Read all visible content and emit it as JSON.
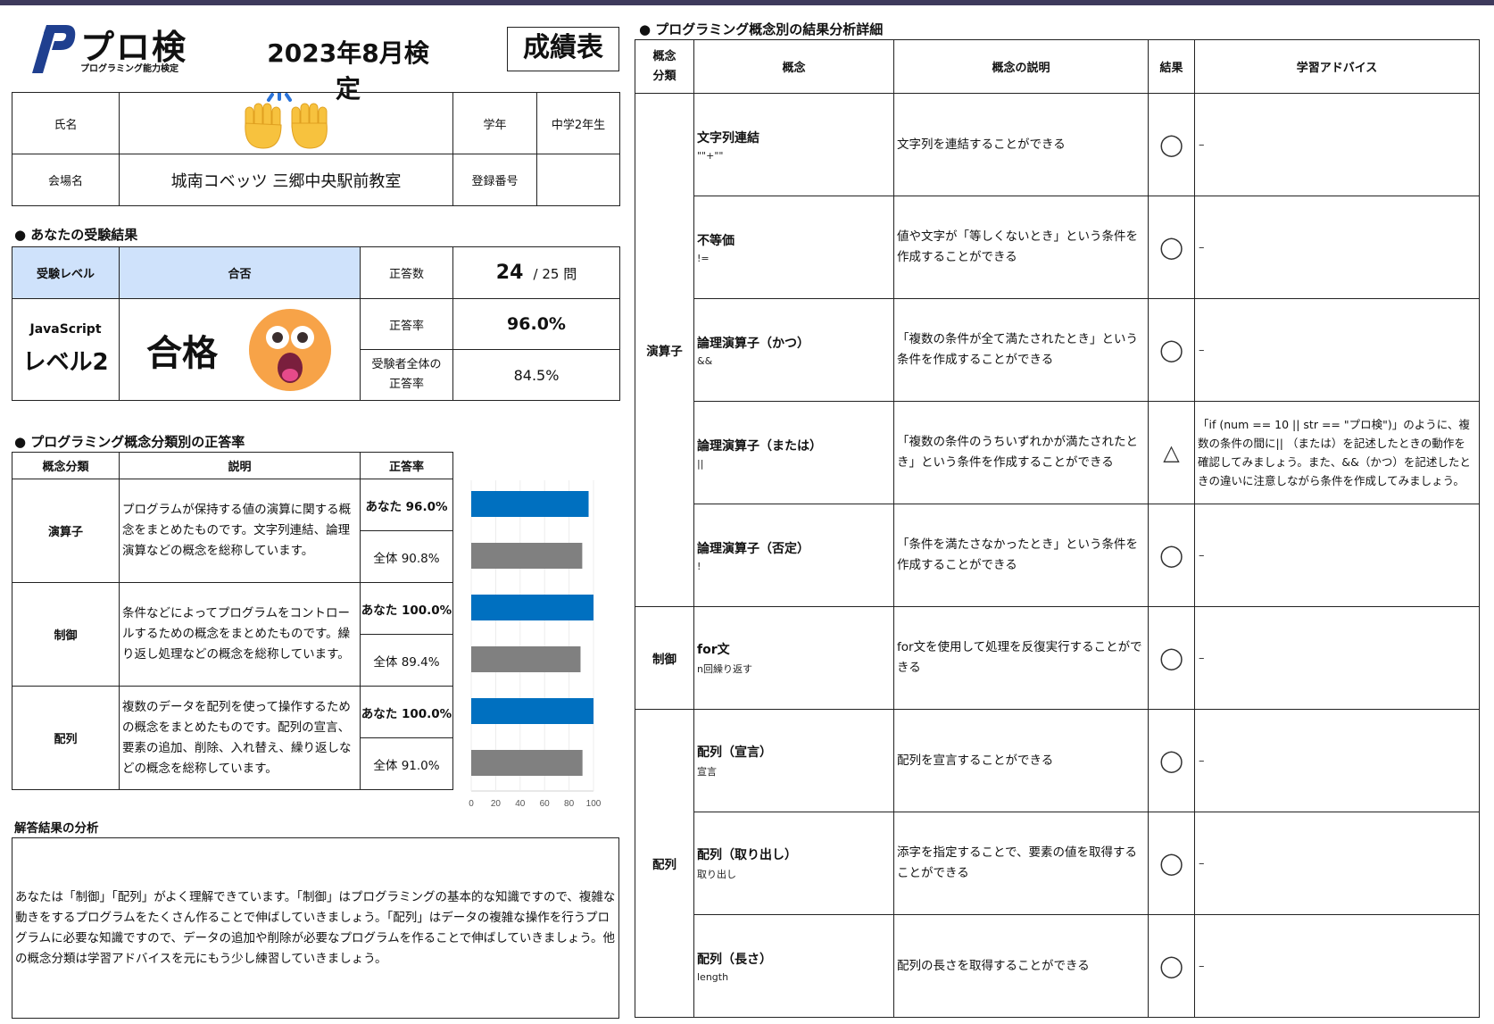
{
  "header": {
    "logo_text": "プロ検",
    "logo_sub": "プログラミング能力検定",
    "exam_date": "2023年8月検定",
    "report_title": "成績表"
  },
  "info": {
    "name_label": "氏名",
    "grade_label": "学年",
    "grade_value": "中学2年生",
    "venue_label": "会場名",
    "venue_value": "城南コベッツ 三郷中央駅前教室",
    "reg_label": "登録番号",
    "reg_value": ""
  },
  "result": {
    "section_title": "● あなたの受験結果",
    "level_header": "受験レベル",
    "pass_header": "合否",
    "level_lang": "JavaScript",
    "level_value": "レベル2",
    "pass_value": "合格",
    "correct_label": "正答数",
    "correct_value": "24",
    "correct_total": "/ 25 問",
    "rate_label": "正答率",
    "rate_value": "96.0%",
    "all_rate_label_1": "受験者全体の",
    "all_rate_label_2": "正答率",
    "all_rate_value": "84.5%"
  },
  "category": {
    "section_title": "● プログラミング概念分類別の正答率",
    "headers": [
      "概念分類",
      "説明",
      "正答率"
    ],
    "rows": [
      {
        "name": "演算子",
        "desc": "プログラムが保持する値の演算に関する概念をまとめたものです。文字列連結、論理演算などの概念を総称しています。",
        "you": "あなた 96.0%",
        "all": "全体 90.8%"
      },
      {
        "name": "制御",
        "desc": "条件などによってプログラムをコントロールするための概念をまとめたものです。繰り返し処理などの概念を総称しています。",
        "you": "あなた 100.0%",
        "all": "全体 89.4%"
      },
      {
        "name": "配列",
        "desc": "複数のデータを配列を使って操作するための概念をまとめたものです。配列の宣言、要素の追加、削除、入れ替え、繰り返しなどの概念を総称しています。",
        "you": "あなた 100.0%",
        "all": "全体 91.0%"
      }
    ]
  },
  "chart_data": {
    "type": "bar",
    "orientation": "horizontal",
    "categories": [
      "演算子",
      "制御",
      "配列"
    ],
    "series": [
      {
        "values": [
          96.0,
          100.0,
          100.0
        ],
        "color": "#0070c0"
      },
      {
        "values": [
          90.8,
          89.4,
          91.0
        ],
        "color": "#808080"
      }
    ],
    "xlim": [
      0,
      100
    ],
    "xticks": [
      "0",
      "20",
      "40",
      "60",
      "80",
      "100"
    ]
  },
  "analysis": {
    "title": "解答結果の分析",
    "text": "あなたは「制御」「配列」がよく理解できています。「制御」はプログラミングの基本的な知識ですので、複雑な動きをするプログラムをたくさん作ることで伸ばしていきましょう。「配列」はデータの複雑な操作を行うプログラムに必要な知識ですので、データの追加や削除が必要なプログラムを作ることで伸ばしていきましょう。他の概念分類は学習アドバイスを元にもう少し練習していきましょう。"
  },
  "detail": {
    "section_title": "● プログラミング概念別の結果分析詳細",
    "headers": {
      "category_1": "概念",
      "category_2": "分類",
      "concept": "概念",
      "description": "概念の説明",
      "result": "結果",
      "advice": "学習アドバイス"
    },
    "groups": [
      "演算子",
      "制御",
      "配列"
    ],
    "rows": [
      {
        "name": "文字列連結",
        "code": "\"\"+\"\"",
        "desc": "文字列を連結することができる",
        "mark": "◯",
        "advice": "–"
      },
      {
        "name": "不等価",
        "code": "!=",
        "desc": "値や文字が「等しくないとき」という条件を作成することができる",
        "mark": "◯",
        "advice": "–"
      },
      {
        "name": "論理演算子（かつ）",
        "code": "&&",
        "desc": "「複数の条件が全て満たされたとき」という条件を作成することができる",
        "mark": "◯",
        "advice": "–"
      },
      {
        "name": "論理演算子（または）",
        "code": "||",
        "desc": "「複数の条件のうちいずれかが満たされたとき」という条件を作成することができる",
        "mark": "△",
        "advice": "「if (num == 10 || str == \"プロ検\")」のように、複数の条件の間に|| （または）を記述したときの動作を確認してみましょう。また、&&（かつ）を記述したときの違いに注意しながら条件を作成してみましょう。"
      },
      {
        "name": "論理演算子（否定）",
        "code": "!",
        "desc": "「条件を満たさなかったとき」という条件を作成することができる",
        "mark": "◯",
        "advice": "–"
      },
      {
        "name": "for文",
        "code": "n回繰り返す",
        "desc": "for文を使用して処理を反復実行することができる",
        "mark": "◯",
        "advice": "–"
      },
      {
        "name": "配列（宣言）",
        "code": "宣言",
        "desc": "配列を宣言することができる",
        "mark": "◯",
        "advice": "–"
      },
      {
        "name": "配列（取り出し）",
        "code": "取り出し",
        "desc": "添字を指定することで、要素の値を取得することができる",
        "mark": "◯",
        "advice": "–"
      },
      {
        "name": "配列（長さ）",
        "code": "length",
        "desc": "配列の長さを取得することができる",
        "mark": "◯",
        "advice": "–"
      }
    ]
  }
}
